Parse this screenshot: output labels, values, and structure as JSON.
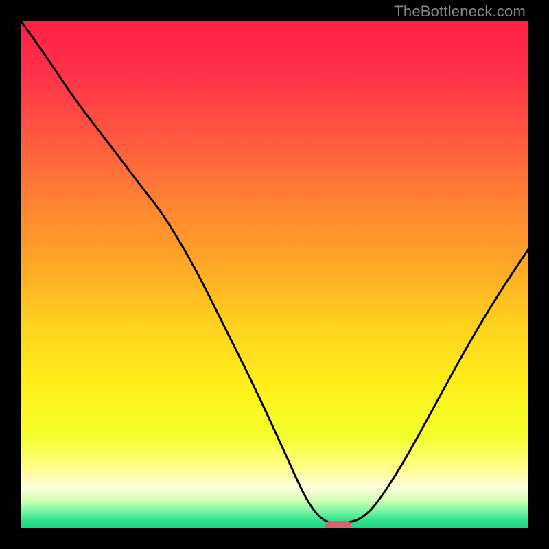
{
  "watermark": "TheBottleneck.com",
  "colors": {
    "frame_bg": "#000000",
    "curve_stroke": "#000000",
    "marker_fill": "#d9626c",
    "gradient_stops": [
      {
        "offset": 0.0,
        "color": "#ff1f47"
      },
      {
        "offset": 0.1,
        "color": "#ff3049"
      },
      {
        "offset": 0.22,
        "color": "#ff5640"
      },
      {
        "offset": 0.35,
        "color": "#ff8033"
      },
      {
        "offset": 0.48,
        "color": "#ffa726"
      },
      {
        "offset": 0.6,
        "color": "#ffd21e"
      },
      {
        "offset": 0.72,
        "color": "#fff01a"
      },
      {
        "offset": 0.82,
        "color": "#f3ff2c"
      },
      {
        "offset": 0.88,
        "color": "#ffff8a"
      },
      {
        "offset": 0.92,
        "color": "#fefede"
      },
      {
        "offset": 0.945,
        "color": "#d3ffb0"
      },
      {
        "offset": 0.965,
        "color": "#7cf7a6"
      },
      {
        "offset": 0.985,
        "color": "#2fe28a"
      },
      {
        "offset": 1.0,
        "color": "#18d781"
      }
    ]
  },
  "chart_data": {
    "type": "line",
    "title": "",
    "xlabel": "",
    "ylabel": "",
    "xlim": [
      0,
      1
    ],
    "ylim": [
      0,
      1
    ],
    "note": "x is normalized horizontal position left→right; y is bottleneck severity where 1.0 = top (red, worst) and 0.0 = bottom (green, best). The curve shows a V-shaped dip with the optimum near x≈0.63.",
    "x": [
      0.0,
      0.05,
      0.11,
      0.18,
      0.24,
      0.28,
      0.34,
      0.4,
      0.46,
      0.52,
      0.565,
      0.6,
      0.64,
      0.675,
      0.71,
      0.76,
      0.82,
      0.88,
      0.94,
      1.0
    ],
    "values": [
      1.0,
      0.93,
      0.84,
      0.75,
      0.67,
      0.62,
      0.52,
      0.4,
      0.28,
      0.15,
      0.05,
      0.01,
      0.01,
      0.02,
      0.06,
      0.14,
      0.25,
      0.36,
      0.46,
      0.55
    ],
    "optimum": {
      "x": 0.625,
      "y": 0.005
    }
  }
}
